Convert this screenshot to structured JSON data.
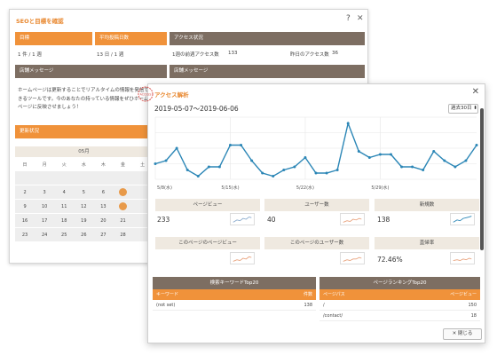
{
  "back_panel": {
    "title": "SEOと目標を確認",
    "help": "?",
    "close": "✕",
    "goal_header": "目標",
    "goal_value": "1 件 / 1 週",
    "frequency_header": "平均投稿日数",
    "frequency_value": "13 日 / 1 週",
    "access_header": "アクセス状況",
    "access_prev_week_label": "1週の前週アクセス数",
    "access_prev_week_value": "133",
    "access_yesterday_label": "昨日のアクセス数",
    "access_yesterday_value": "36",
    "message_header_left": "店舗メッセージ",
    "message_header_right": "店舗メッセージ",
    "message_text": "ホームページは更新することでリアルタイムの情報を発信できるツールです。今のあなたの持っている情報をぜひホームページに反映させましょう！",
    "update_header": "更新状況",
    "calendar": {
      "month": "05月",
      "weekdays": [
        "日",
        "月",
        "火",
        "水",
        "木",
        "金",
        "土"
      ],
      "rows": [
        [
          "",
          "",
          "",
          "",
          "",
          "",
          ""
        ],
        [
          "2",
          "3",
          "4",
          "5",
          "6",
          "",
          ""
        ],
        [
          "9",
          "10",
          "11",
          "12",
          "13",
          "",
          ""
        ],
        [
          "16",
          "17",
          "18",
          "19",
          "20",
          "21",
          ""
        ],
        [
          "23",
          "24",
          "25",
          "26",
          "27",
          "28",
          ""
        ]
      ],
      "icon_cells": [
        "1-5",
        "2-5"
      ]
    }
  },
  "modal": {
    "title": "アクセス解析",
    "close": "✕",
    "date_range": "2019-05-07〜2019-06-06",
    "period_select": "過去30日 ⬍",
    "logo_text": "ACCESS",
    "metrics": [
      {
        "label": "ページビュー",
        "value": "233"
      },
      {
        "label": "ユーザー数",
        "value": "40"
      },
      {
        "label": "新規数",
        "value": "138"
      },
      {
        "label": "このページのページビュー",
        "value": ""
      },
      {
        "label": "このページのユーザー数",
        "value": ""
      },
      {
        "label": "直帰率",
        "value": "72.46%"
      }
    ],
    "keyword_table": {
      "title": "検索キーワードTop20",
      "col_keyword": "キーワード",
      "col_count": "件数",
      "rows": [
        {
          "keyword": "(not set)",
          "count": "138"
        }
      ]
    },
    "page_table": {
      "title": "ページランキングTop20",
      "col_path": "ページパス",
      "col_views": "ページビュー",
      "rows": [
        {
          "path": "/",
          "views": "150"
        },
        {
          "path": "/contact/",
          "views": "18"
        }
      ]
    },
    "close_button": "✕ 閉じる"
  },
  "colors": {
    "accent_orange": "#f0923a",
    "brown_header": "#7d6e62",
    "line_blue": "#2b86b6"
  },
  "chart_data": {
    "type": "line",
    "x_labels": [
      "5/8(水)",
      "5/15(水)",
      "5/22(水)",
      "5/29(水)"
    ],
    "values": [
      5,
      6,
      10,
      3,
      1,
      4,
      4,
      11,
      11,
      6,
      2,
      1,
      3,
      4,
      7,
      2,
      2,
      3,
      18,
      9,
      7,
      8,
      8,
      4,
      4,
      3,
      9,
      6,
      4,
      6,
      11
    ],
    "ylim": [
      0,
      20
    ],
    "grid": true
  }
}
